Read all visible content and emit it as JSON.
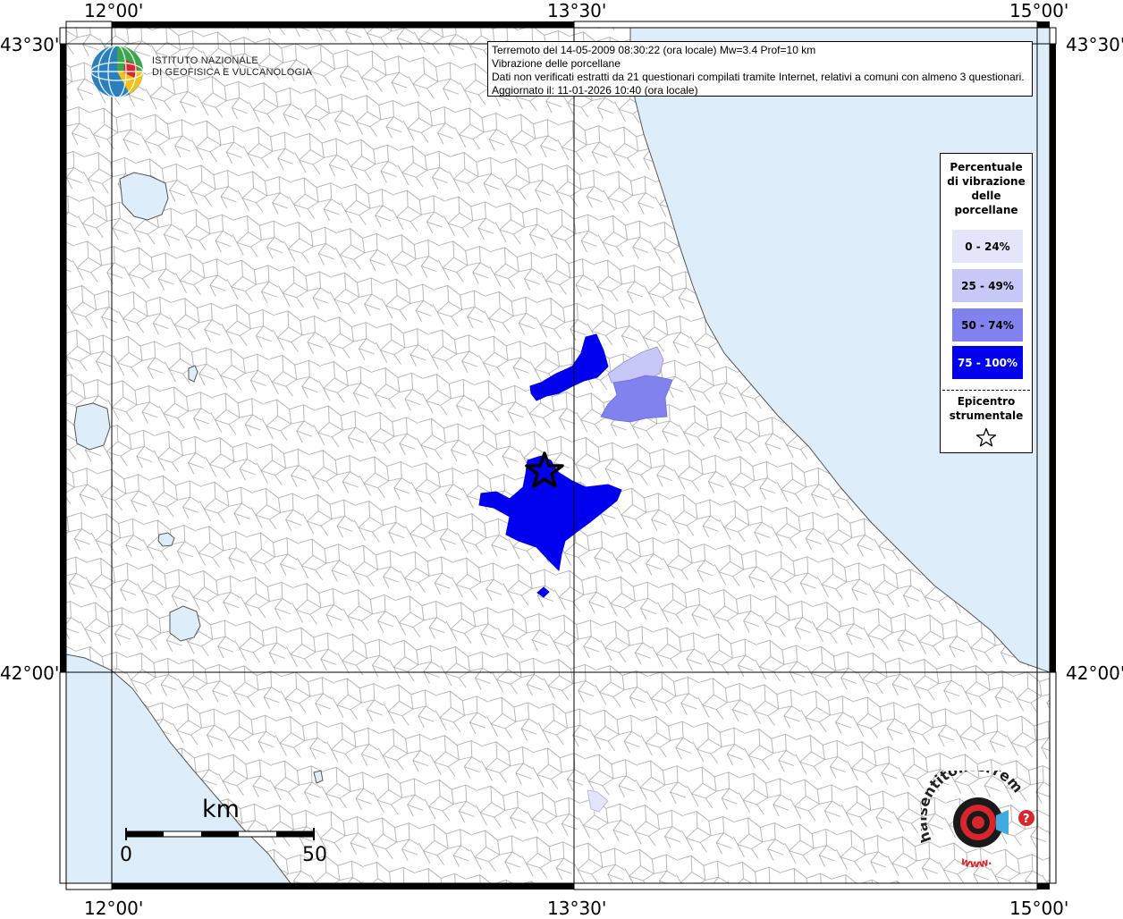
{
  "map": {
    "coord_labels": {
      "top": [
        "12°00'",
        "13°30'",
        "15°00'"
      ],
      "bottom": [
        "12°00'",
        "13°30'",
        "15°00'"
      ],
      "left": [
        "43°30'",
        "42°00'"
      ],
      "right": [
        "43°30'",
        "42°00'"
      ]
    },
    "colors": {
      "sea": "#ddeefa",
      "land": "#ffffff",
      "borders": "#9e9e9e",
      "class_0_24": "#e4e4fb",
      "class_25_49": "#c8c8f7",
      "class_50_74": "#8282ef",
      "class_75_100": "#0000ee"
    }
  },
  "info": {
    "line1": "Terremoto del 14-05-2009 08:30:22 (ora locale) Mw=3.4 Prof=10 km",
    "line2": "Vibrazione delle porcellane",
    "line3": "Dati non verificati estratti da 21 questionari compilati tramite Internet, relativi a comuni con almeno 3 questionari.",
    "line4": "Aggiornato il: 11-01-2026 10:40 (ora locale)"
  },
  "legend": {
    "title": "Percentuale di vibrazione delle porcellane",
    "classes": [
      {
        "label": "0 - 24%",
        "color": "#e4e4fb",
        "text_color": "#000000"
      },
      {
        "label": "25 - 49%",
        "color": "#c8c8f7",
        "text_color": "#000000"
      },
      {
        "label": "50 - 74%",
        "color": "#8282ef",
        "text_color": "#000000"
      },
      {
        "label": "75 - 100%",
        "color": "#0000ee",
        "text_color": "#ffffff"
      }
    ],
    "epicenter_label": "Epicentro strumentale",
    "epicenter_icon": "star-outline-icon"
  },
  "logo": {
    "line1": "ISTITUTO NAZIONALE",
    "line2": "DI GEOFISICA E VULCANOLOGIA",
    "site_text": "haisentitoilterremoto.it",
    "site_prefix": "www.",
    "site_suffix": "?"
  },
  "scale": {
    "title": "km",
    "start": "0",
    "end": "50"
  }
}
